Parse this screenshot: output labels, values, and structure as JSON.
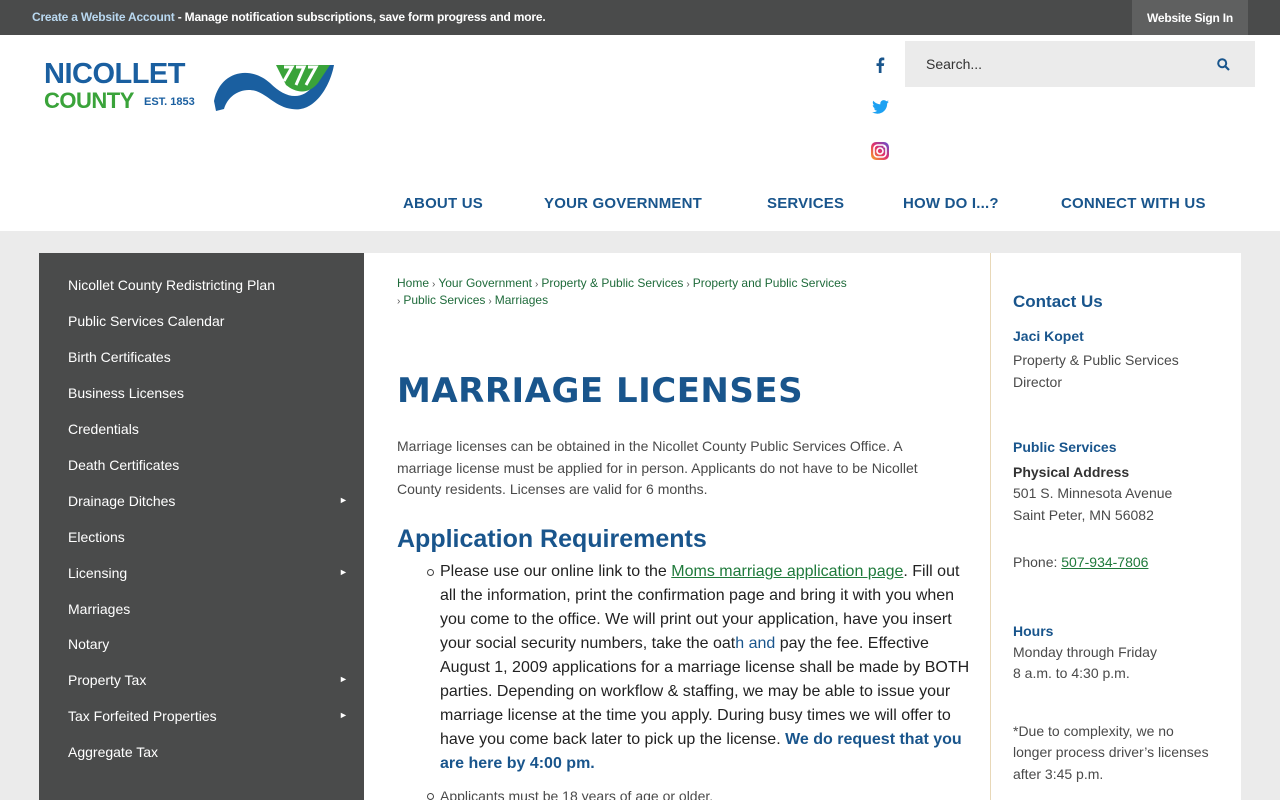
{
  "topbar": {
    "account_link": "Create a Website Account",
    "account_message": " - Manage notification subscriptions, save form progress and more.",
    "sign_in": "Website Sign In"
  },
  "logo": {
    "line1": "NICOLLET",
    "line2": "COUNTY",
    "est": "EST. 1853"
  },
  "search": {
    "placeholder": "Search..."
  },
  "social": [
    "facebook-icon",
    "twitter-icon",
    "instagram-icon"
  ],
  "nav": [
    "ABOUT US",
    "YOUR GOVERNMENT",
    "SERVICES",
    "HOW DO I...?",
    "CONNECT WITH US"
  ],
  "sidebar": {
    "items": [
      {
        "label": "Nicollet County Redistricting Plan",
        "sub": false
      },
      {
        "label": "Public Services Calendar",
        "sub": false
      },
      {
        "label": "Birth Certificates",
        "sub": false
      },
      {
        "label": "Business Licenses",
        "sub": false
      },
      {
        "label": "Credentials",
        "sub": false
      },
      {
        "label": "Death Certificates",
        "sub": false
      },
      {
        "label": "Drainage Ditches",
        "sub": true
      },
      {
        "label": "Elections",
        "sub": false
      },
      {
        "label": "Licensing",
        "sub": true
      },
      {
        "label": "Marriages",
        "sub": false
      },
      {
        "label": "Notary",
        "sub": false
      },
      {
        "label": "Property Tax",
        "sub": true
      },
      {
        "label": "Tax Forfeited Properties",
        "sub": true
      },
      {
        "label": "Aggregate Tax",
        "sub": false
      }
    ]
  },
  "breadcrumb": {
    "line1": [
      "Home",
      "Your Government",
      "Property & Public Services",
      "Property and Public Services"
    ],
    "line2": [
      "Public Services",
      "Marriages"
    ]
  },
  "main": {
    "title": "MARRIAGE LICENSES",
    "intro": "Marriage licenses can be obtained in the Nicollet County Public Services Office. A marriage license must be applied for in person. Applicants do not have to be Nicollet County residents. Licenses are valid for 6 months.",
    "req_heading": "Application Requirements",
    "b1_pre": "Please use our online link to the ",
    "b1_link": "Moms marriage application page",
    "b1_mid": ". Fill out all the information, print the confirmation page and bring it with you when you come to the office.  We will print out your application, have you insert your social security numbers, take the oat",
    "b1_blue": "h and ",
    "b1_post": " pay the fee. Effective August 1, 2009 applications for a marriage license shall be made by BOTH parties. Depending on workflow & staffing, we may be able to issue your marriage license at the time you apply. During busy times we will offer to have you come back later to pick up the license. ",
    "b1_strong": "We do request that you are here by 4:00 pm.",
    "b2": "Applicants must be 18 years of age or older."
  },
  "contact": {
    "heading": "Contact Us",
    "name": "Jaci Kopet",
    "role1": "Property & Public Services",
    "role2": "Director",
    "dept": "Public Services",
    "addr_label": "Physical Address",
    "addr1": "501 S. Minnesota Avenue",
    "addr2": "Saint Peter, MN 56082",
    "phone_label": "Phone: ",
    "phone": "507-934-7806",
    "hours_heading": "Hours",
    "hours1": "Monday through Friday",
    "hours2": "8 a.m. to 4:30 p.m.",
    "note1": "*Due to complexity, we no",
    "note2": "longer process driver’s licenses",
    "note3": "after 3:45 p.m."
  },
  "colors": {
    "brand_blue": "#19558c",
    "brand_green": "#3aa33a",
    "link_green": "#1f7a3b",
    "sidebar_bg": "#4a4b4b"
  }
}
